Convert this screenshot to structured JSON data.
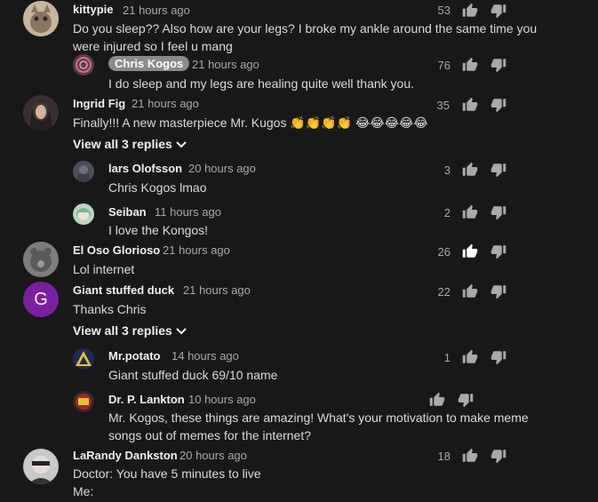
{
  "comments": [
    {
      "author": "kittypie",
      "time": "21 hours ago",
      "text": "Do you sleep?? Also how are your legs? I broke my ankle around the same time you were injured so I feel u mang",
      "likes": "53"
    },
    {
      "author": "Chris Kogos",
      "time": "21 hours ago",
      "text": "I do sleep and my legs are healing quite well thank you.",
      "likes": "76"
    },
    {
      "author": "Ingrid Fig",
      "time": "21 hours ago",
      "text": "Finally!!! A new masterpiece Mr. Kugos 👏👏👏👏 😂😂😂😂😂",
      "likes": "35"
    },
    {
      "author": "lars Olofsson",
      "time": "20 hours ago",
      "text": "Chris Kogos lmao",
      "likes": "3"
    },
    {
      "author": "Seiban",
      "time": "11 hours ago",
      "text": "I love the Kongos!",
      "likes": "2"
    },
    {
      "author": "El Oso Glorioso",
      "time": "21 hours ago",
      "text": "Lol internet",
      "likes": "26"
    },
    {
      "author": "Giant stuffed duck",
      "time": "21 hours ago",
      "text": "Thanks Chris",
      "likes": "22",
      "avatar_letter": "G"
    },
    {
      "author": "Mr.potato",
      "time": "14 hours ago",
      "text": "Giant stuffed duck 69/10 name",
      "likes": "1"
    },
    {
      "author": "Dr. P. Lankton",
      "time": "10 hours ago",
      "text": "Mr. Kogos, these things are amazing! What's your motivation to make meme songs out of memes for the internet?",
      "likes": ""
    },
    {
      "author": "LaRandy Dankston",
      "time": "20 hours ago",
      "text": "Doctor: You have 5 minutes to live",
      "text2": "Me:",
      "likes": "18"
    }
  ],
  "view_replies_1": "View all 3 replies",
  "view_replies_2": "View all 3 replies",
  "colors": {
    "background": "#181818",
    "badge": "#8a8a8a",
    "avatar_g": "#7b1fa2"
  }
}
